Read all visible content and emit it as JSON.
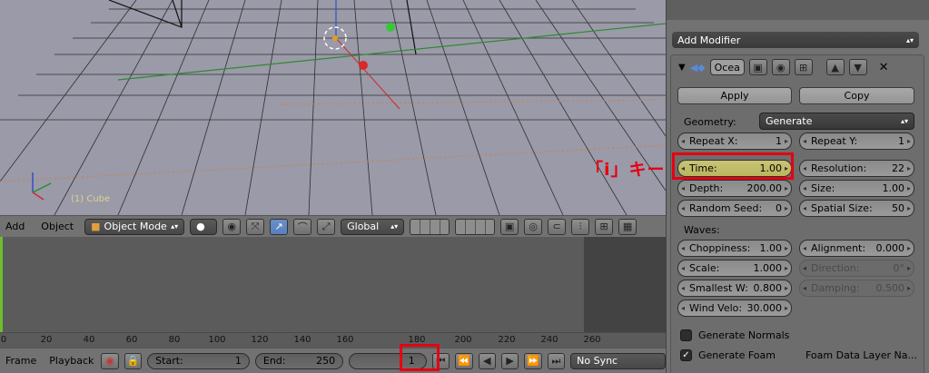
{
  "viewport": {
    "object_label": "(1) Cube"
  },
  "view3d_header": {
    "menus": [
      "Add",
      "Object"
    ],
    "mode": "Object Mode",
    "orientation": "Global"
  },
  "timeline": {
    "ticks": [
      "0",
      "20",
      "40",
      "60",
      "80",
      "100",
      "120",
      "140",
      "160",
      "180",
      "200",
      "220",
      "240",
      "260"
    ],
    "menus": [
      "Frame",
      "Playback"
    ],
    "start_label": "Start:",
    "start_value": "1",
    "end_label": "End:",
    "end_value": "250",
    "current_frame": "1",
    "sync": "No Sync"
  },
  "properties": {
    "add_modifier": "Add Modifier",
    "modifier_name": "Ocea",
    "apply": "Apply",
    "copy": "Copy",
    "geometry_label": "Geometry:",
    "geometry_value": "Generate",
    "fields": {
      "repeat_x": {
        "label": "Repeat X:",
        "value": "1"
      },
      "repeat_y": {
        "label": "Repeat Y:",
        "value": "1"
      },
      "time": {
        "label": "Time:",
        "value": "1.00"
      },
      "resolution": {
        "label": "Resolution:",
        "value": "22"
      },
      "depth": {
        "label": "Depth:",
        "value": "200.00"
      },
      "size": {
        "label": "Size:",
        "value": "1.00"
      },
      "random_seed": {
        "label": "Random Seed:",
        "value": "0"
      },
      "spatial_size": {
        "label": "Spatial Size:",
        "value": "50"
      },
      "choppiness": {
        "label": "Choppiness:",
        "value": "1.00"
      },
      "alignment": {
        "label": "Alignment:",
        "value": "0.000"
      },
      "scale": {
        "label": "Scale:",
        "value": "1.000"
      },
      "direction": {
        "label": "Direction:",
        "value": "0°"
      },
      "smallest_w": {
        "label": "Smallest W:",
        "value": "0.800"
      },
      "damping": {
        "label": "Damping:",
        "value": "0.500"
      },
      "wind_velo": {
        "label": "Wind Velo:",
        "value": "30.000"
      }
    },
    "waves_label": "Waves:",
    "generate_normals": "Generate Normals",
    "generate_foam": "Generate Foam",
    "foam_layer": "Foam Data Layer Na..."
  },
  "annotation": "「i」キー",
  "colors": {
    "highlight_box": "#e60012",
    "time_field": "#c9c474",
    "frame_line": "#6fbd2f"
  }
}
